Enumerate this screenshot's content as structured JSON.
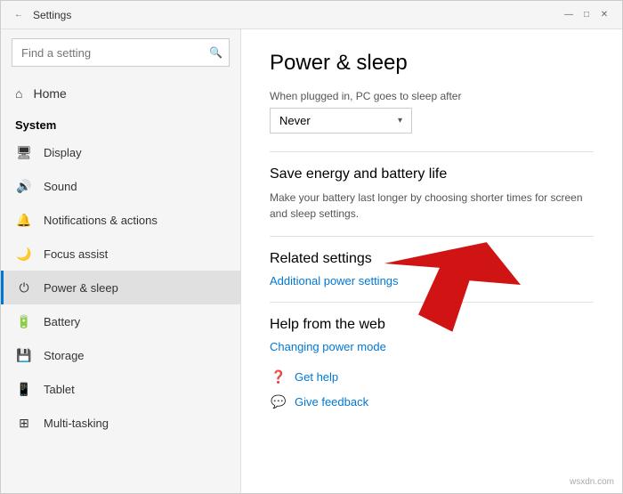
{
  "window": {
    "title": "Settings",
    "back_icon": "←",
    "min_icon": "—",
    "max_icon": "□",
    "close_icon": "✕"
  },
  "sidebar": {
    "search_placeholder": "Find a setting",
    "search_icon": "🔍",
    "home_label": "Home",
    "section_label": "System",
    "items": [
      {
        "id": "display",
        "label": "Display",
        "icon": "🖥"
      },
      {
        "id": "sound",
        "label": "Sound",
        "icon": "🔊"
      },
      {
        "id": "notifications",
        "label": "Notifications & actions",
        "icon": "🔔"
      },
      {
        "id": "focus",
        "label": "Focus assist",
        "icon": "🌙"
      },
      {
        "id": "power",
        "label": "Power & sleep",
        "icon": "⏻",
        "active": true
      },
      {
        "id": "battery",
        "label": "Battery",
        "icon": "🔋"
      },
      {
        "id": "storage",
        "label": "Storage",
        "icon": "💾"
      },
      {
        "id": "tablet",
        "label": "Tablet",
        "icon": "📱"
      },
      {
        "id": "multitasking",
        "label": "Multi-tasking",
        "icon": "⊞"
      }
    ]
  },
  "main": {
    "page_title": "Power & sleep",
    "plugged_label": "When plugged in, PC goes to sleep after",
    "dropdown_value": "Never",
    "dropdown_arrow": "▾",
    "energy_section": {
      "heading": "Save energy and battery life",
      "desc": "Make your battery last longer by choosing shorter times for screen and sleep settings."
    },
    "related_section": {
      "heading": "Related settings",
      "link": "Additional power settings"
    },
    "help_section": {
      "heading": "Help from the web",
      "link": "Changing power mode"
    },
    "get_help_label": "Get help",
    "feedback_label": "Give feedback",
    "watermark": "wsxdn.com"
  }
}
